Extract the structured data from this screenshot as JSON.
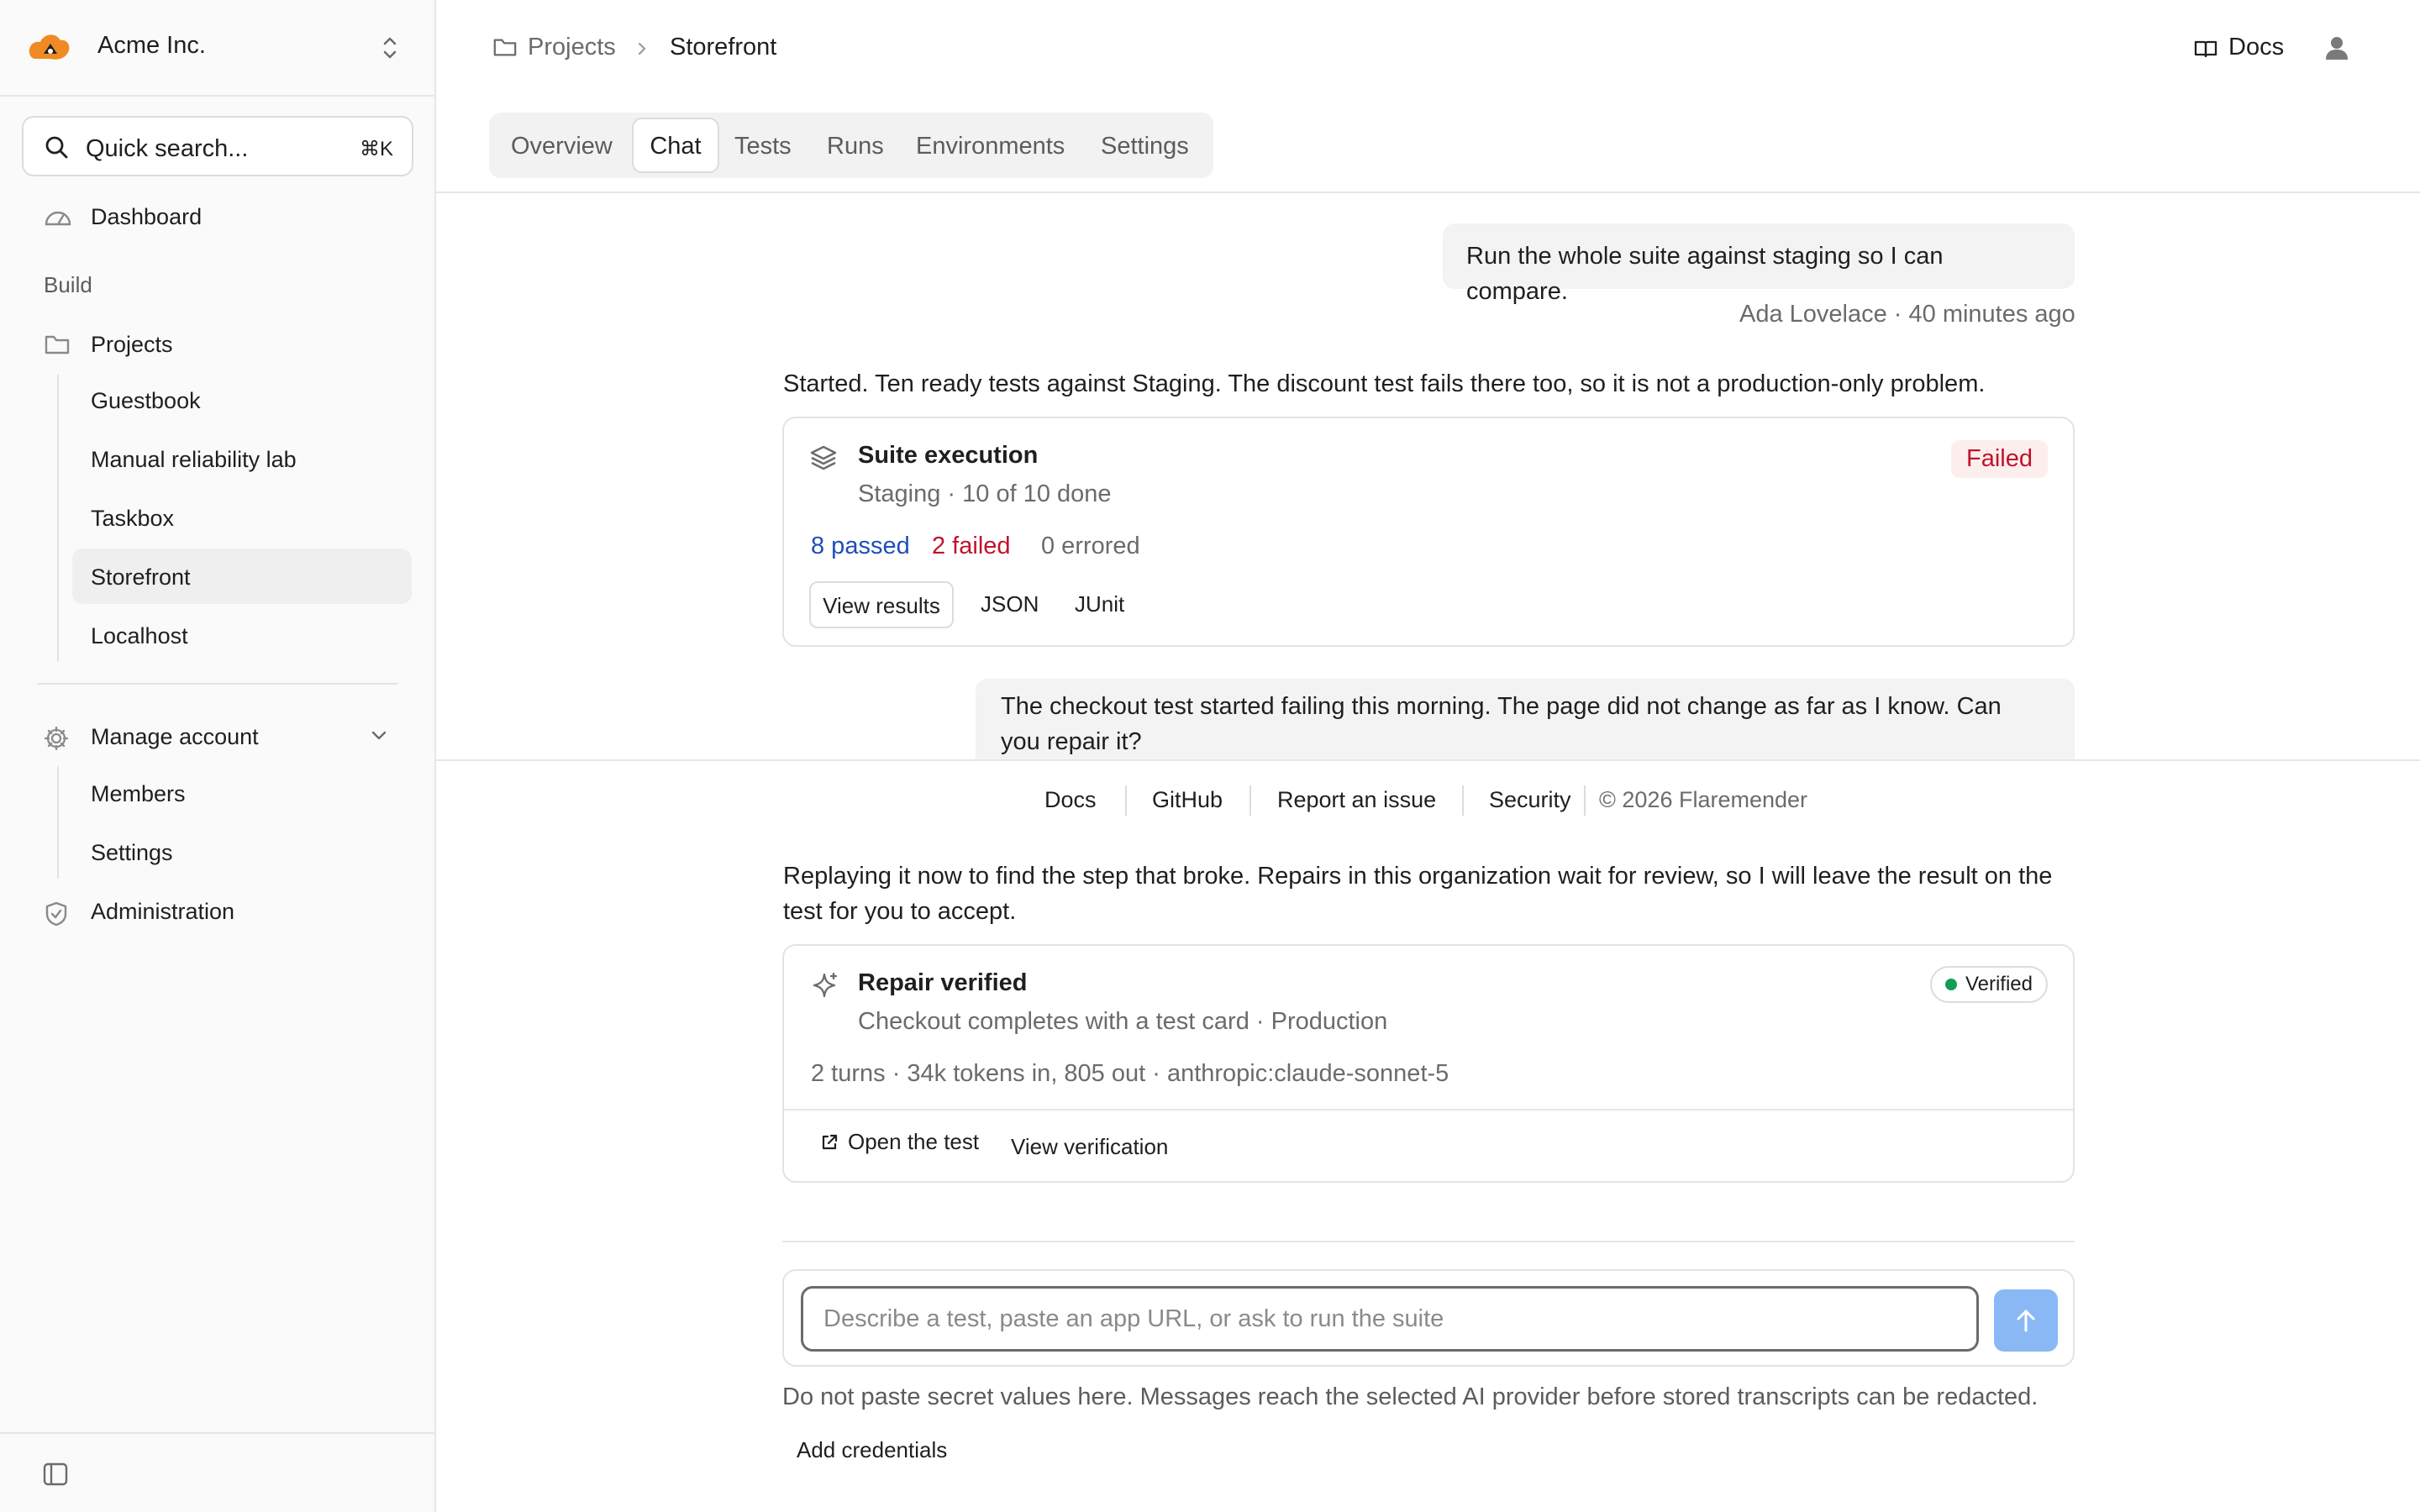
{
  "org": {
    "name": "Acme Inc."
  },
  "search": {
    "label": "Quick search...",
    "shortcut": "⌘K"
  },
  "sidebar": {
    "dashboard": "Dashboard",
    "section_build": "Build",
    "projects": "Projects",
    "project_items": [
      "Guestbook",
      "Manual reliability lab",
      "Taskbox",
      "Storefront",
      "Localhost"
    ],
    "active_project": "Storefront",
    "manage_account": "Manage account",
    "account_items": [
      "Members",
      "Settings"
    ],
    "administration": "Administration"
  },
  "breadcrumb": {
    "parent": "Projects",
    "current": "Storefront"
  },
  "header": {
    "docs": "Docs"
  },
  "tabs": [
    "Overview",
    "Chat",
    "Tests",
    "Runs",
    "Environments",
    "Settings"
  ],
  "active_tab": "Chat",
  "chat": {
    "msg1": {
      "text": "Run the whole suite against staging so I can compare.",
      "meta": "Ada Lovelace · 40 minutes ago"
    },
    "reply1": "Started. Ten ready tests against Staging. The discount test fails there too, so it is not a production-only problem.",
    "suite_card": {
      "title": "Suite execution",
      "subtitle": "Staging · 10 of 10 done",
      "status": "Failed",
      "passed": "8 passed",
      "failed": "2 failed",
      "errored": "0 errored",
      "view_results": "View results",
      "json": "JSON",
      "junit": "JUnit"
    },
    "msg2": {
      "line1": "The checkout test started failing this morning. The page did not change as far as I know. Can",
      "line2": "you repair it?"
    },
    "reply2": {
      "line1": "Replaying it now to find the step that broke. Repairs in this organization wait for review, so I will leave the result on the",
      "line2": "test for you to accept."
    },
    "repair_card": {
      "title": "Repair verified",
      "subtitle": "Checkout completes with a test card · Production",
      "status": "Verified",
      "stats": "2 turns · 34k tokens in, 805 out · anthropic:claude-sonnet-5",
      "open_test": "Open the test",
      "view_verification": "View verification"
    }
  },
  "footer": {
    "links": [
      "Docs",
      "GitHub",
      "Report an issue",
      "Security"
    ],
    "copyright": "© 2026 Flaremender"
  },
  "composer": {
    "placeholder": "Describe a test, paste an app URL, or ask to run the suite",
    "disclaimer": "Do not paste secret values here. Messages reach the selected AI provider before stored transcripts can be redacted.",
    "add_credentials": "Add credentials"
  },
  "colors": {
    "accent_orange": "#f08a24",
    "passed_blue": "#1f4fb5",
    "failed_red": "#c0122b",
    "verified_green": "#0f9d58",
    "send_button": "#8ab8f5"
  },
  "icons": [
    "flame-logo-icon",
    "chevron-updown-icon",
    "search-icon",
    "gauge-icon",
    "folder-icon",
    "gear-icon",
    "chevron-down-icon",
    "shield-icon",
    "sidebar-toggle-icon",
    "book-icon",
    "user-icon",
    "layers-icon",
    "sparkle-icon",
    "external-link-icon",
    "arrow-up-icon"
  ]
}
